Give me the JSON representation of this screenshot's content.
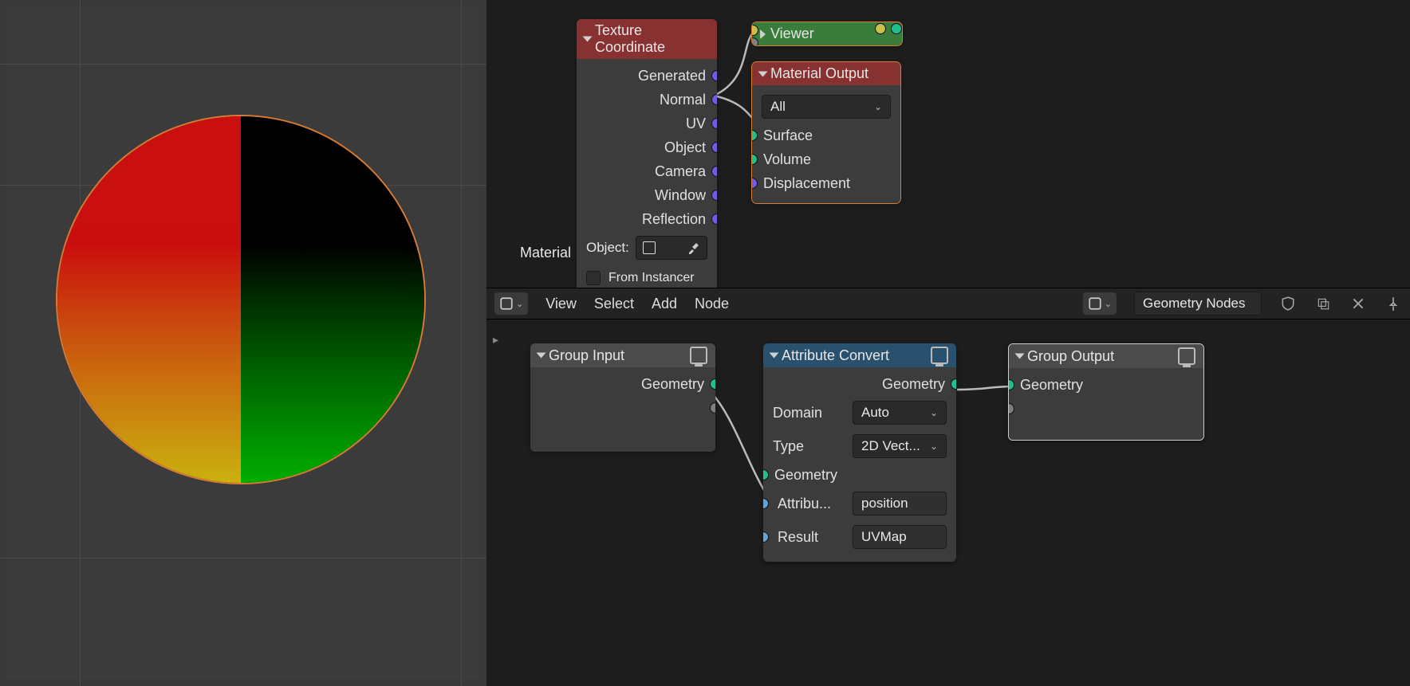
{
  "viewport": {
    "label": "Material"
  },
  "texcoord": {
    "title": "Texture Coordinate",
    "outputs": [
      "Generated",
      "Normal",
      "UV",
      "Object",
      "Camera",
      "Window",
      "Reflection"
    ],
    "object_label": "Object:",
    "from_instancer": "From Instancer"
  },
  "viewer": {
    "title": "Viewer"
  },
  "matout": {
    "title": "Material Output",
    "dropdown": "All",
    "inputs": [
      "Surface",
      "Volume",
      "Displacement"
    ]
  },
  "geo_header": {
    "menus": [
      "View",
      "Select",
      "Add",
      "Node"
    ],
    "title": "Geometry Nodes"
  },
  "group_input": {
    "title": "Group Input",
    "out": "Geometry"
  },
  "attr_convert": {
    "title": "Attribute Convert",
    "out": "Geometry",
    "domain_label": "Domain",
    "domain_value": "Auto",
    "type_label": "Type",
    "type_value": "2D Vect...",
    "in_geom": "Geometry",
    "attr_label": "Attribu...",
    "attr_value": "position",
    "result_label": "Result",
    "result_value": "UVMap"
  },
  "group_output": {
    "title": "Group Output",
    "in": "Geometry"
  }
}
